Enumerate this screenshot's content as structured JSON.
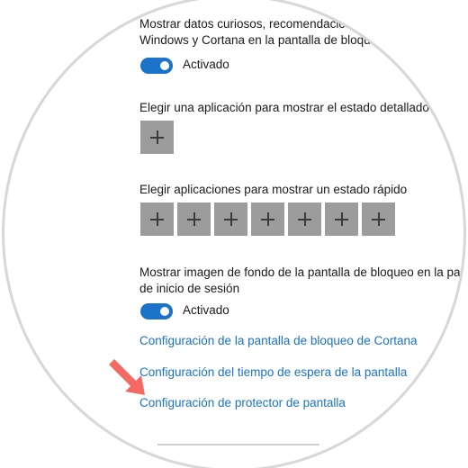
{
  "settings": {
    "fun_facts_line1": "Mostrar datos curiosos, recomendaciones",
    "fun_facts_line2": "Windows y Cortana en la pantalla de bloqueo",
    "fun_facts_toggle_label": "Activado",
    "detailed_status_label": "Elegir una aplicación para mostrar el estado detallado",
    "quick_status_label": "Elegir aplicaciones para mostrar un estado rápido",
    "quick_status_buttons": 7,
    "background_line1": "Mostrar imagen de fondo de la pantalla de bloqueo en la pant",
    "background_line2": "de inicio de sesión",
    "background_toggle_label": "Activado",
    "link_cortana": "Configuración de la pantalla de bloqueo de Cortana",
    "link_timeout": "Configuración del tiempo de espera de la pantalla",
    "link_screensaver": "Configuración de protector de pantalla"
  },
  "colors": {
    "accent": "#1a73c8",
    "tile": "#9c9c9c",
    "arrow": "#f26a61"
  },
  "icons": {
    "plus": "plus-icon",
    "pointer": "arrow-icon"
  }
}
